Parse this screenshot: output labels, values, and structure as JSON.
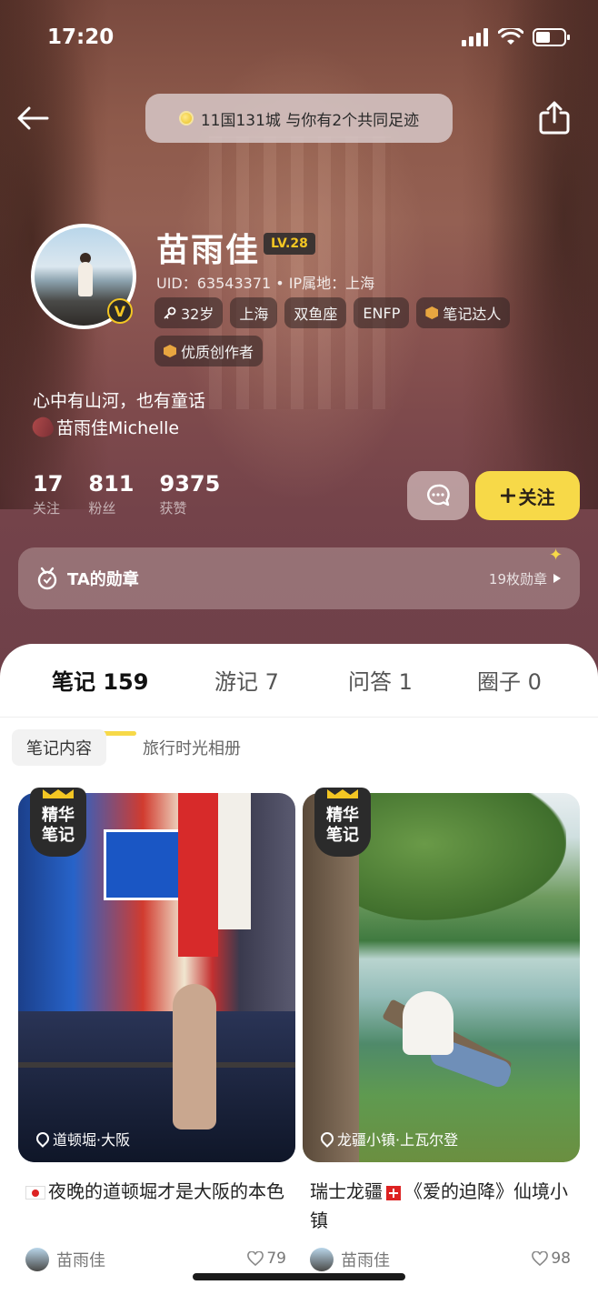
{
  "status_bar": {
    "time": "17:20"
  },
  "header": {
    "footprint_text": "11国131城 与你有2个共同足迹"
  },
  "profile": {
    "name": "苗雨佳",
    "level": "LV.28",
    "uid_line": "UID：63543371 • IP属地：上海",
    "tags": [
      {
        "label": "32岁",
        "icon": "age-key-icon"
      },
      {
        "label": "上海",
        "icon": ""
      },
      {
        "label": "双鱼座",
        "icon": ""
      },
      {
        "label": "ENFP",
        "icon": ""
      },
      {
        "label": "笔记达人",
        "icon": "hexagon-badge-icon"
      },
      {
        "label": "优质创作者",
        "icon": "hexagon-badge-icon"
      }
    ],
    "bio": "心中有山河，也有童话",
    "sub_name": "苗雨佳Michelle",
    "stats": [
      {
        "num": "17",
        "label": "关注"
      },
      {
        "num": "811",
        "label": "粉丝"
      },
      {
        "num": "9375",
        "label": "获赞"
      }
    ],
    "follow_label": "关注",
    "medal_title": "TA的勋章",
    "medal_count": "19枚勋章"
  },
  "tabs": [
    {
      "label": "笔记 159",
      "active": true
    },
    {
      "label": "游记 7",
      "active": false
    },
    {
      "label": "问答 1",
      "active": false
    },
    {
      "label": "圈子 0",
      "active": false
    }
  ],
  "subtabs": [
    {
      "label": "笔记内容",
      "active": true
    },
    {
      "label": "旅行时光相册",
      "active": false
    }
  ],
  "cards": [
    {
      "badge_line1": "精华",
      "badge_line2": "笔记",
      "location": "道顿堀·大阪",
      "title": "夜晚的道顿堀才是大阪的本色",
      "author": "苗雨佳",
      "likes": "79"
    },
    {
      "badge_line1": "精华",
      "badge_line2": "笔记",
      "location": "龙疆小镇·上瓦尔登",
      "title_part1": "瑞士龙疆",
      "title_part2": "《爱的迫降》仙境小镇",
      "author": "苗雨佳",
      "likes": "98"
    }
  ],
  "colors": {
    "accent_yellow": "#f7d948",
    "badge_gold": "#f3c623"
  }
}
